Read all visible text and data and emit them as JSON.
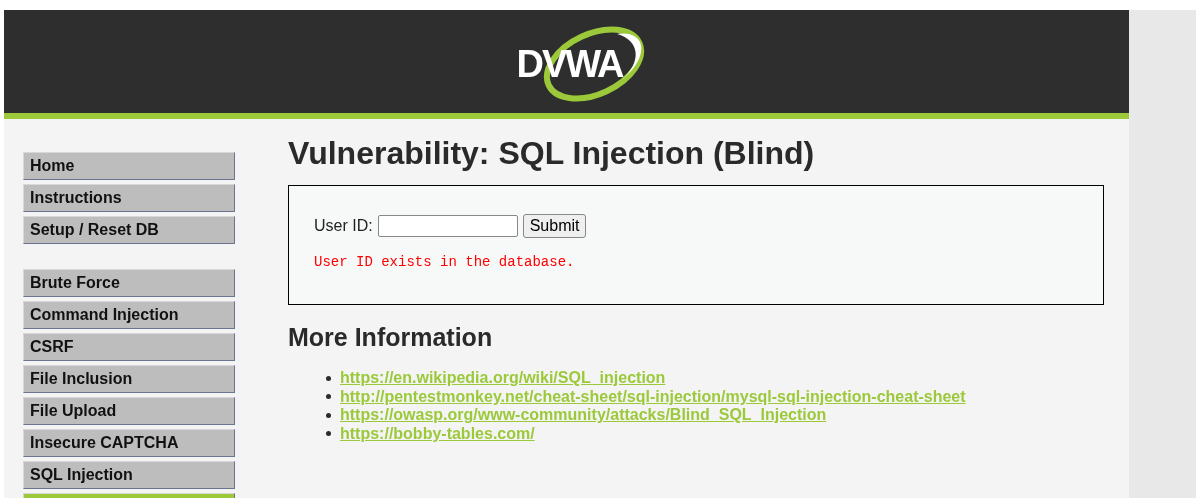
{
  "header": {
    "logo_text": "DVWA"
  },
  "menu": [
    {
      "items": [
        {
          "label": "Home",
          "selected": false
        },
        {
          "label": "Instructions",
          "selected": false
        },
        {
          "label": "Setup / Reset DB",
          "selected": false
        }
      ]
    },
    {
      "items": [
        {
          "label": "Brute Force",
          "selected": false
        },
        {
          "label": "Command Injection",
          "selected": false
        },
        {
          "label": "CSRF",
          "selected": false
        },
        {
          "label": "File Inclusion",
          "selected": false
        },
        {
          "label": "File Upload",
          "selected": false
        },
        {
          "label": "Insecure CAPTCHA",
          "selected": false
        },
        {
          "label": "SQL Injection",
          "selected": false
        },
        {
          "selected": true
        }
      ]
    }
  ],
  "main": {
    "title": "Vulnerability: SQL Injection (Blind)",
    "form": {
      "label": "User ID:",
      "button": "Submit",
      "message": "User ID exists in the database."
    },
    "more_title": "More Information",
    "links": [
      "https://en.wikipedia.org/wiki/SQL_injection",
      "http://pentestmonkey.net/cheat-sheet/sql-injection/mysql-sql-injection-cheat-sheet",
      "https://owasp.org/www-community/attacks/Blind_SQL_Injection",
      "https://bobby-tables.com/"
    ]
  }
}
